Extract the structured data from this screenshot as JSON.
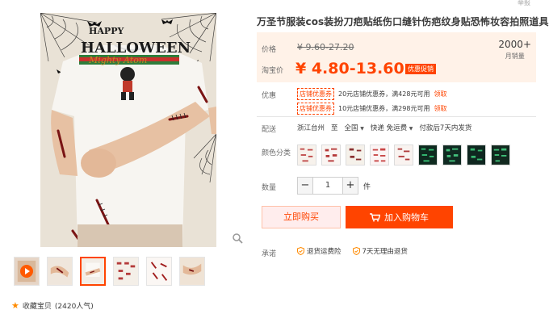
{
  "header": {
    "report_label": "举报"
  },
  "product": {
    "title": "万圣节服装cos装扮刀疤贴纸伤口缝针伤疤纹身贴恐怖妆容拍照道具",
    "image_text": [
      "HAPPY",
      "HALLOWEEN",
      "Mighty Atom"
    ]
  },
  "price": {
    "price_label": "价格",
    "original_price": "¥ 9.60-27.20",
    "taobao_label": "淘宝价",
    "promo_price": "¥ 4.80-13.60",
    "promo_tag": "优惠促销",
    "sales_count": "2000+",
    "sales_unit": "月销量"
  },
  "coupons": {
    "label": "优惠",
    "items": [
      {
        "tag": "店铺优惠券",
        "text": "20元店铺优惠券，满428元可用",
        "action": "领取"
      },
      {
        "tag": "店铺优惠券",
        "text": "10元店铺优惠券，满298元可用",
        "action": "领取"
      }
    ]
  },
  "delivery": {
    "label": "配送",
    "from": "浙江台州",
    "to_label": "至",
    "to": "全国",
    "shipping": "快递 免运费",
    "promise": "付款后7天内发货"
  },
  "options": {
    "label": "颜色分类",
    "swatch_count": 9
  },
  "quantity": {
    "label": "数量",
    "minus": "−",
    "value": "1",
    "plus": "+",
    "unit": "件"
  },
  "actions": {
    "buy_now": "立即购买",
    "add_cart": "加入购物车"
  },
  "guarantee": {
    "label": "承诺",
    "items": [
      "退货运费险",
      "7天无理由退货"
    ]
  },
  "gallery": {
    "favorite": "收藏宝贝",
    "favorite_count": "(2420人气)"
  },
  "colors": {
    "accent": "#ff4400",
    "price_bg": "#fff2e8"
  }
}
